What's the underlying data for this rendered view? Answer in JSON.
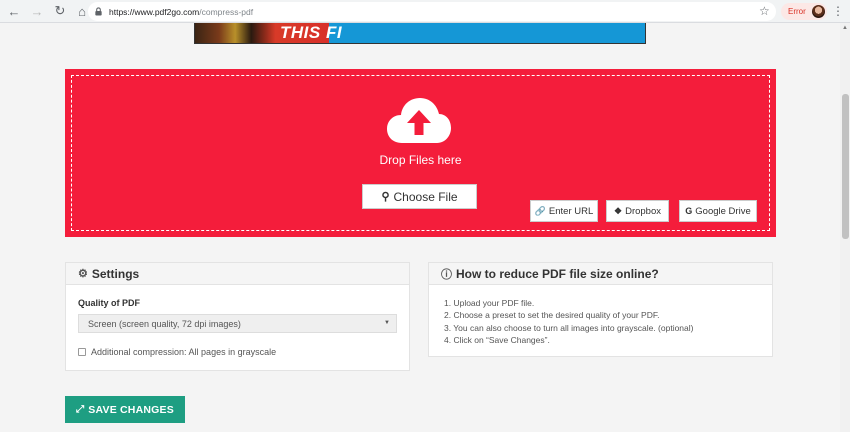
{
  "browser": {
    "url_host": "https://www.pdf2go.com",
    "url_path": "/compress-pdf",
    "error_label": "Error"
  },
  "ad": {
    "text": "THIS FI"
  },
  "upload": {
    "drop_text": "Drop Files here",
    "choose_label": "Choose File",
    "url_label": "Enter URL",
    "dropbox_label": "Dropbox",
    "gdrive_label": "Google Drive"
  },
  "settings": {
    "title": "Settings",
    "quality_label": "Quality of PDF",
    "quality_value": "Screen (screen quality, 72 dpi images)",
    "grayscale_label": "Additional compression: All pages in grayscale",
    "grayscale_checked": false
  },
  "howto": {
    "title": "How to reduce PDF file size online?",
    "steps": [
      "1. Upload your PDF file.",
      "2. Choose a preset to set the desired quality of your PDF.",
      "3. You can also choose to turn all images into grayscale. (optional)",
      "4. Click on “Save Changes”."
    ]
  },
  "actions": {
    "save_label": "SAVE CHANGES"
  },
  "colors": {
    "dropzone": "#f41d3b",
    "save": "#1e9e82"
  }
}
